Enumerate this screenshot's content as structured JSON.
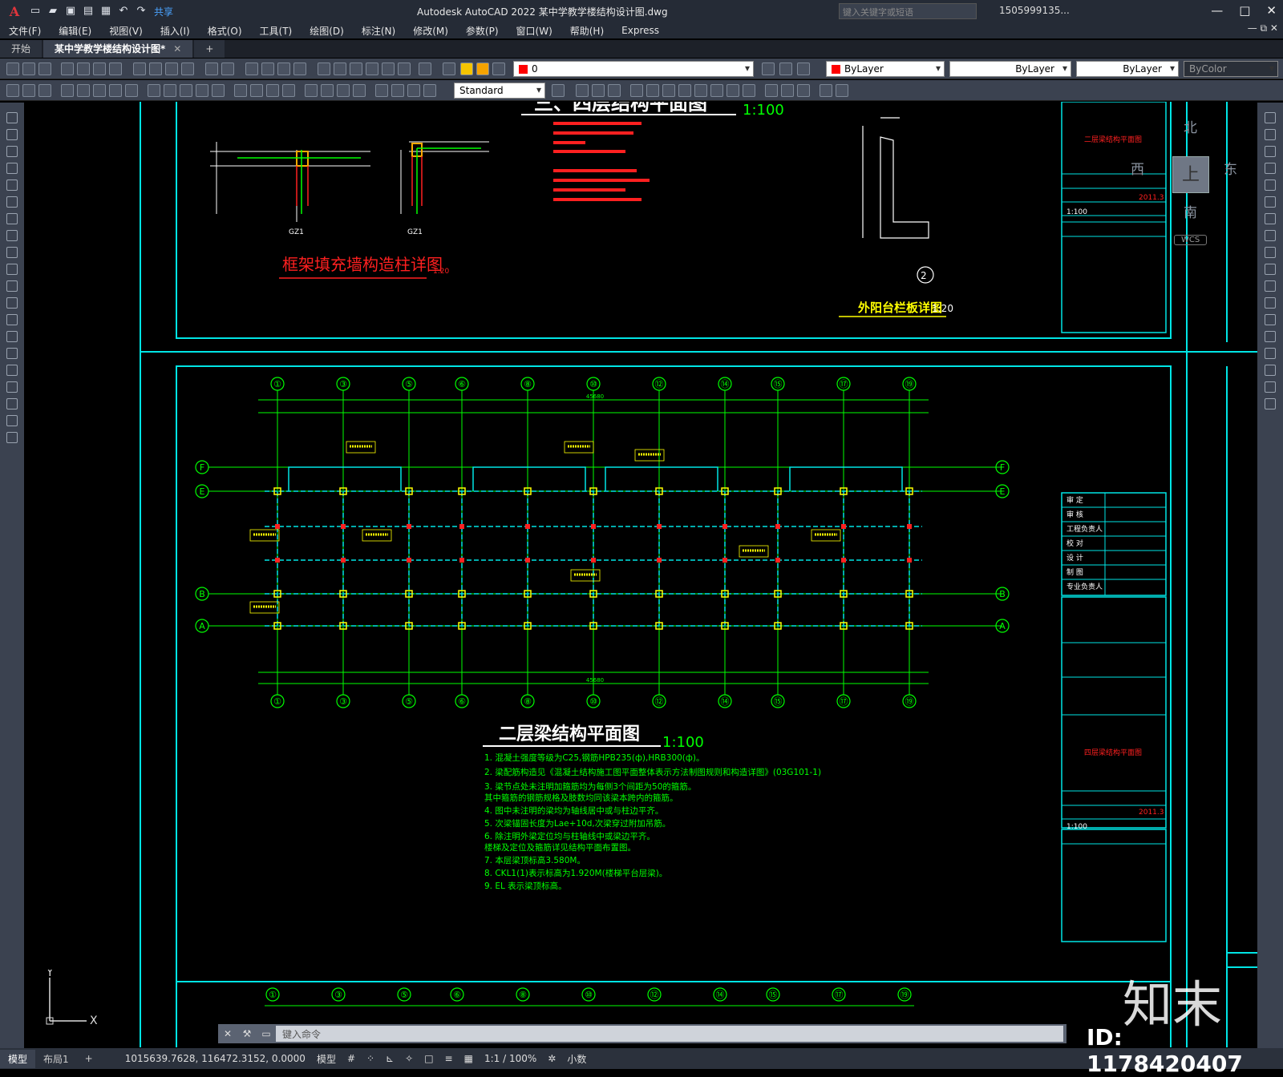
{
  "titlebar": {
    "logo": "A",
    "share": "共享",
    "title": "Autodesk AutoCAD 2022    某中学教学楼结构设计图.dwg",
    "search_placeholder": "键入关键字或短语",
    "user": "1505999135...",
    "qat_icons": [
      "new-icon",
      "open-icon",
      "save-icon",
      "saveas-icon",
      "plot-icon",
      "undo-icon",
      "redo-icon"
    ]
  },
  "menu": [
    "文件(F)",
    "编辑(E)",
    "视图(V)",
    "插入(I)",
    "格式(O)",
    "工具(T)",
    "绘图(D)",
    "标注(N)",
    "修改(M)",
    "参数(P)",
    "窗口(W)",
    "帮助(H)",
    "Express"
  ],
  "tabs": [
    {
      "label": "开始"
    },
    {
      "label": "某中学教学楼结构设计图*"
    }
  ],
  "toolbar": {
    "layer": "0",
    "color": "ByLayer",
    "linetype": "ByLayer",
    "lineweight": "ByLayer",
    "plotstyle": "ByColor",
    "textstyle": "Standard"
  },
  "compass": {
    "n": "北",
    "s": "南",
    "e": "东",
    "w": "西",
    "top": "上",
    "wcs": "WCS"
  },
  "drawing": {
    "title_top": "三、四层结构平面图",
    "title_top_scale": "1:100",
    "title_detail": "框架填充墙构造柱详图",
    "title_detail_scale": "1:20",
    "title_balcony": "外阳台栏板详图",
    "title_balcony_scale": "1:20",
    "title_main": "二层梁结构平面图",
    "title_main_scale": "1:100",
    "gz": "GZ1",
    "axes_top": [
      "①",
      "③",
      "⑤",
      "⑥",
      "⑧",
      "⑩",
      "⑫",
      "⑭",
      "⑮",
      "⑰",
      "⑲"
    ],
    "axes_side": [
      "F",
      "E",
      "B",
      "A"
    ],
    "total_dim": "45680",
    "notes": [
      "1. 混凝土强度等级为C25,钢筋HPB235(ф),HRB300(ф)。",
      "2. 梁配筋构造见《混凝土结构施工图平面整体表示方法制图规则和构造详图》(03G101-1)",
      "3. 梁节点处未注明加箍筋均为每侧3个间距为50的箍筋。",
      "   其中箍筋的钢筋规格及肢数均同该梁本跨内的箍筋。",
      "4. 图中未注明的梁均为轴线居中或与柱边平齐。",
      "5. 次梁锚固长度为Lae+10d,次梁穿过附加吊筋。",
      "6. 除注明外梁定位均与柱轴线中或梁边平齐。",
      "   楼梯及定位及箍筋详见结构平面布置图。",
      "7. 本层梁顶标高3.580M。",
      "8. CKL1(1)表示标高为1.920M(楼梯平台层梁)。",
      "9. EL 表示梁顶标高。"
    ],
    "title_block": {
      "sheet1": "二层梁结构平面图",
      "sheet2": "四层梁结构平面图",
      "scale": "1:100",
      "date": "2011.3",
      "rows": [
        "审 定",
        "审 核",
        "工程负责人",
        "校 对",
        "设 计",
        "制 图",
        "专业负责人"
      ]
    }
  },
  "cmd": {
    "placeholder": "键入命令"
  },
  "status": {
    "tabs": [
      "模型",
      "布局1"
    ],
    "coords": "1015639.7628, 116472.3152, 0.0000",
    "model": "模型",
    "scale": "1:1 / 100%",
    "units": "小数"
  },
  "watermark": {
    "text": "知末",
    "id": "ID: 1178420407"
  }
}
